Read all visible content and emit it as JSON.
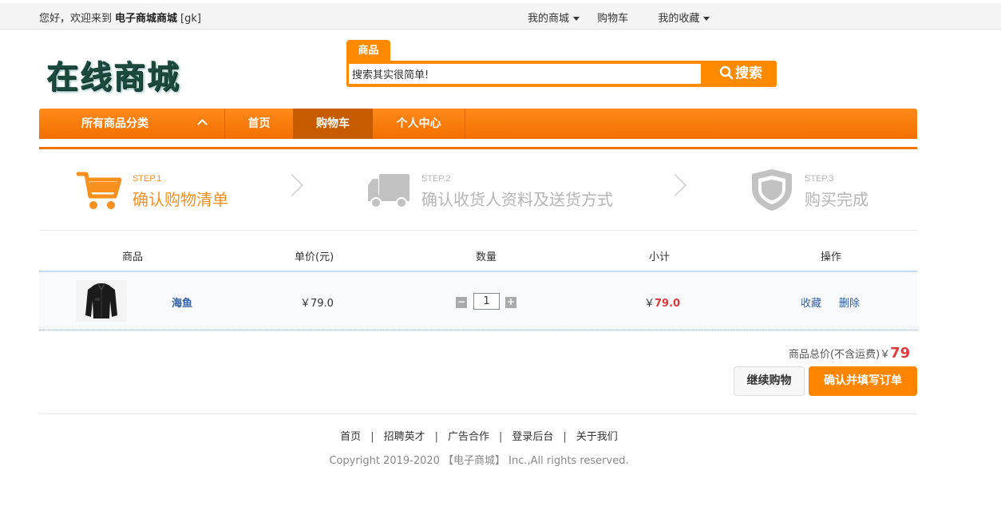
{
  "topbar": {
    "greeting": "您好，欢迎来到",
    "site_name": "电子商城商城",
    "user": "[gk]",
    "links": [
      {
        "label": "我的商城",
        "dropdown": true
      },
      {
        "label": "购物车",
        "dropdown": false
      },
      {
        "label": "我的收藏",
        "dropdown": true
      }
    ]
  },
  "logo": {
    "text": "在线商城"
  },
  "search": {
    "tab_label": "商品",
    "value": "搜索其实很简单!",
    "button_label": "搜索"
  },
  "nav": {
    "category_label": "所有商品分类",
    "items": [
      "首页",
      "购物车",
      "个人中心"
    ],
    "active": "购物车"
  },
  "steps": [
    {
      "no": "STEP.1",
      "label": "确认购物清单",
      "active": true,
      "icon": "cart-icon"
    },
    {
      "no": "STEP.2",
      "label": "确认收货人资料及送货方式",
      "active": false,
      "icon": "truck-icon"
    },
    {
      "no": "STEP.3",
      "label": "购买完成",
      "active": false,
      "icon": "shield-icon"
    }
  ],
  "cart": {
    "columns": [
      "商品",
      "单价(元)",
      "数量",
      "小计",
      "操作"
    ],
    "items": [
      {
        "name": "海鱼",
        "price": "￥79.0",
        "quantity": "1",
        "subtotal_prefix": "￥",
        "subtotal": "79.0",
        "actions": [
          "收藏",
          "删除"
        ]
      }
    ],
    "total_label": "商品总价(不含运费)￥",
    "total_value": "79",
    "continue_label": "继续购物",
    "confirm_label": "确认并填写订单"
  },
  "footer": {
    "links": [
      "首页",
      "招聘英才",
      "广告合作",
      "登录后台",
      "关于我们"
    ],
    "separator": "|",
    "copyright": "Copyright 2019-2020 【电子商城】 Inc.,All rights reserved."
  },
  "colors": {
    "accent": "#ff8a00",
    "nav_active": "#c65b00",
    "price_red": "#e4393c",
    "link_blue": "#2f5da8",
    "step_inactive": "#b5b5b5"
  }
}
